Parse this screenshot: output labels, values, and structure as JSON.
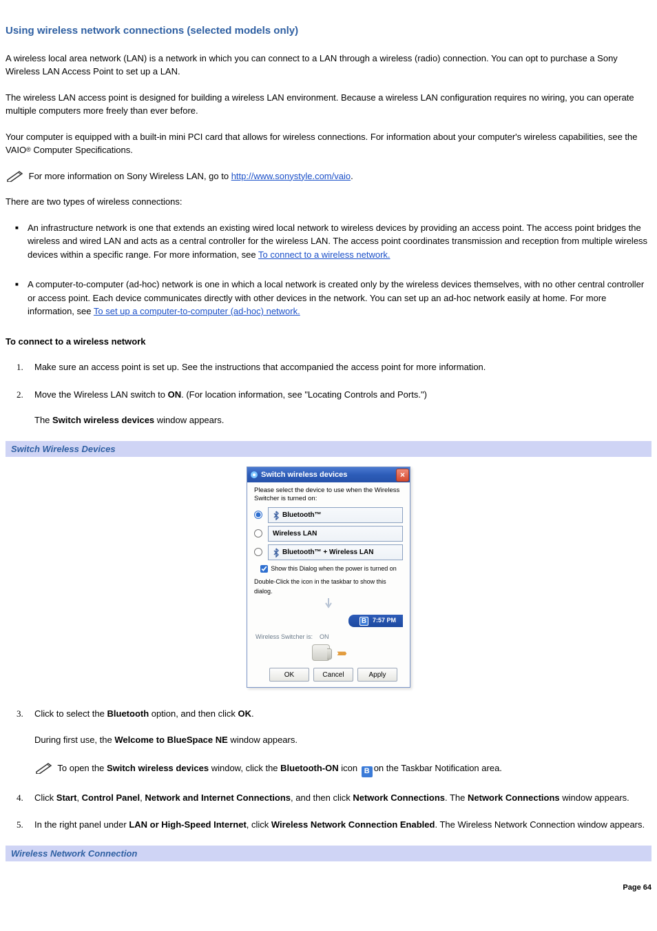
{
  "title": "Using wireless network connections (selected models only)",
  "paragraphs": {
    "p1": "A wireless local area network (LAN) is a network in which you can connect to a LAN through a wireless (radio) connection. You can opt to purchase a Sony Wireless LAN Access Point to set up a LAN.",
    "p2": "The wireless LAN access point is designed for building a wireless LAN environment. Because a wireless LAN configuration requires no wiring, you can operate multiple computers more freely than ever before.",
    "p3a": "Your computer is equipped with a built-in mini PCI card that allows for wireless connections. For information about your computer's wireless capabilities, see the VAIO",
    "p3b": " Computer Specifications."
  },
  "note1": {
    "before": "For more information on Sony Wireless LAN, go to ",
    "link_text": "http://www.sonystyle.com/vaio",
    "after": "."
  },
  "intro2": "There are two types of wireless connections:",
  "bullets": {
    "b1_before": "An infrastructure network is one that extends an existing wired local network to wireless devices by providing an access point. The access point bridges the wireless and wired LAN and acts as a central controller for the wireless LAN. The access point coordinates transmission and reception from multiple wireless devices within a specific range. For more information, see ",
    "b1_link": "To connect to a wireless network.",
    "b2_before": "A computer-to-computer (ad-hoc) network is one in which a local network is created only by the wireless devices themselves, with no other central controller or access point. Each device communicates directly with other devices in the network. You can set up an ad-hoc network easily at home. For more information, see ",
    "b2_link": "To set up a computer-to-computer (ad-hoc) network."
  },
  "subhead1": "To connect to a wireless network",
  "steps": {
    "s1": "Make sure an access point is set up. See the instructions that accompanied the access point for more information.",
    "s2_before": "Move the Wireless LAN switch to ",
    "s2_bold": "ON",
    "s2_after": ". (For location information, see \"Locating Controls and Ports.\")",
    "s2_p_before": "The ",
    "s2_p_bold": "Switch wireless devices",
    "s2_p_after": " window appears.",
    "s3_a": "Click to select the ",
    "s3_b": "Bluetooth",
    "s3_c": " option, and then click ",
    "s3_d": "OK",
    "s3_e": ".",
    "s3_p_a": "During first use, the ",
    "s3_p_b": "Welcome to BlueSpace NE",
    "s3_p_c": " window appears.",
    "s3_note_a": "To open the ",
    "s3_note_b": "Switch wireless devices",
    "s3_note_c": " window, click the ",
    "s3_note_d": "Bluetooth-ON",
    "s3_note_e": " icon ",
    "s3_note_f": "on the Taskbar Notification area.",
    "s4_a": "Click ",
    "s4_b": "Start",
    "s4_c": ", ",
    "s4_d": "Control Panel",
    "s4_e": ", ",
    "s4_f": "Network and Internet Connections",
    "s4_g": ", and then click ",
    "s4_h": "Network Connections",
    "s4_i": ". The ",
    "s4_j": "Network Connections",
    "s4_k": " window appears.",
    "s5_a": "In the right panel under ",
    "s5_b": "LAN or High-Speed Internet",
    "s5_c": ", click ",
    "s5_d": "Wireless Network Connection Enabled",
    "s5_e": ". The Wireless Network Connection window appears."
  },
  "caption1": "Switch Wireless Devices",
  "caption2": "Wireless Network Connection",
  "dialog": {
    "title": "Switch wireless devices",
    "intro": "Please select the device to use when the Wireless Switcher is turned on:",
    "opt1": "Bluetooth™",
    "opt2": "Wireless LAN",
    "opt3": "Bluetooth™ + Wireless LAN",
    "checkbox": "Show this Dialog when the power is turned on",
    "dbl": "Double-Click the icon in the taskbar to show this dialog.",
    "tray_time": "7:57 PM",
    "status_label": "Wireless Switcher is:",
    "status_value": "ON",
    "btn_ok": "OK",
    "btn_cancel": "Cancel",
    "btn_apply": "Apply"
  },
  "page_label": "Page 64",
  "glyph": {
    "B": "B"
  }
}
